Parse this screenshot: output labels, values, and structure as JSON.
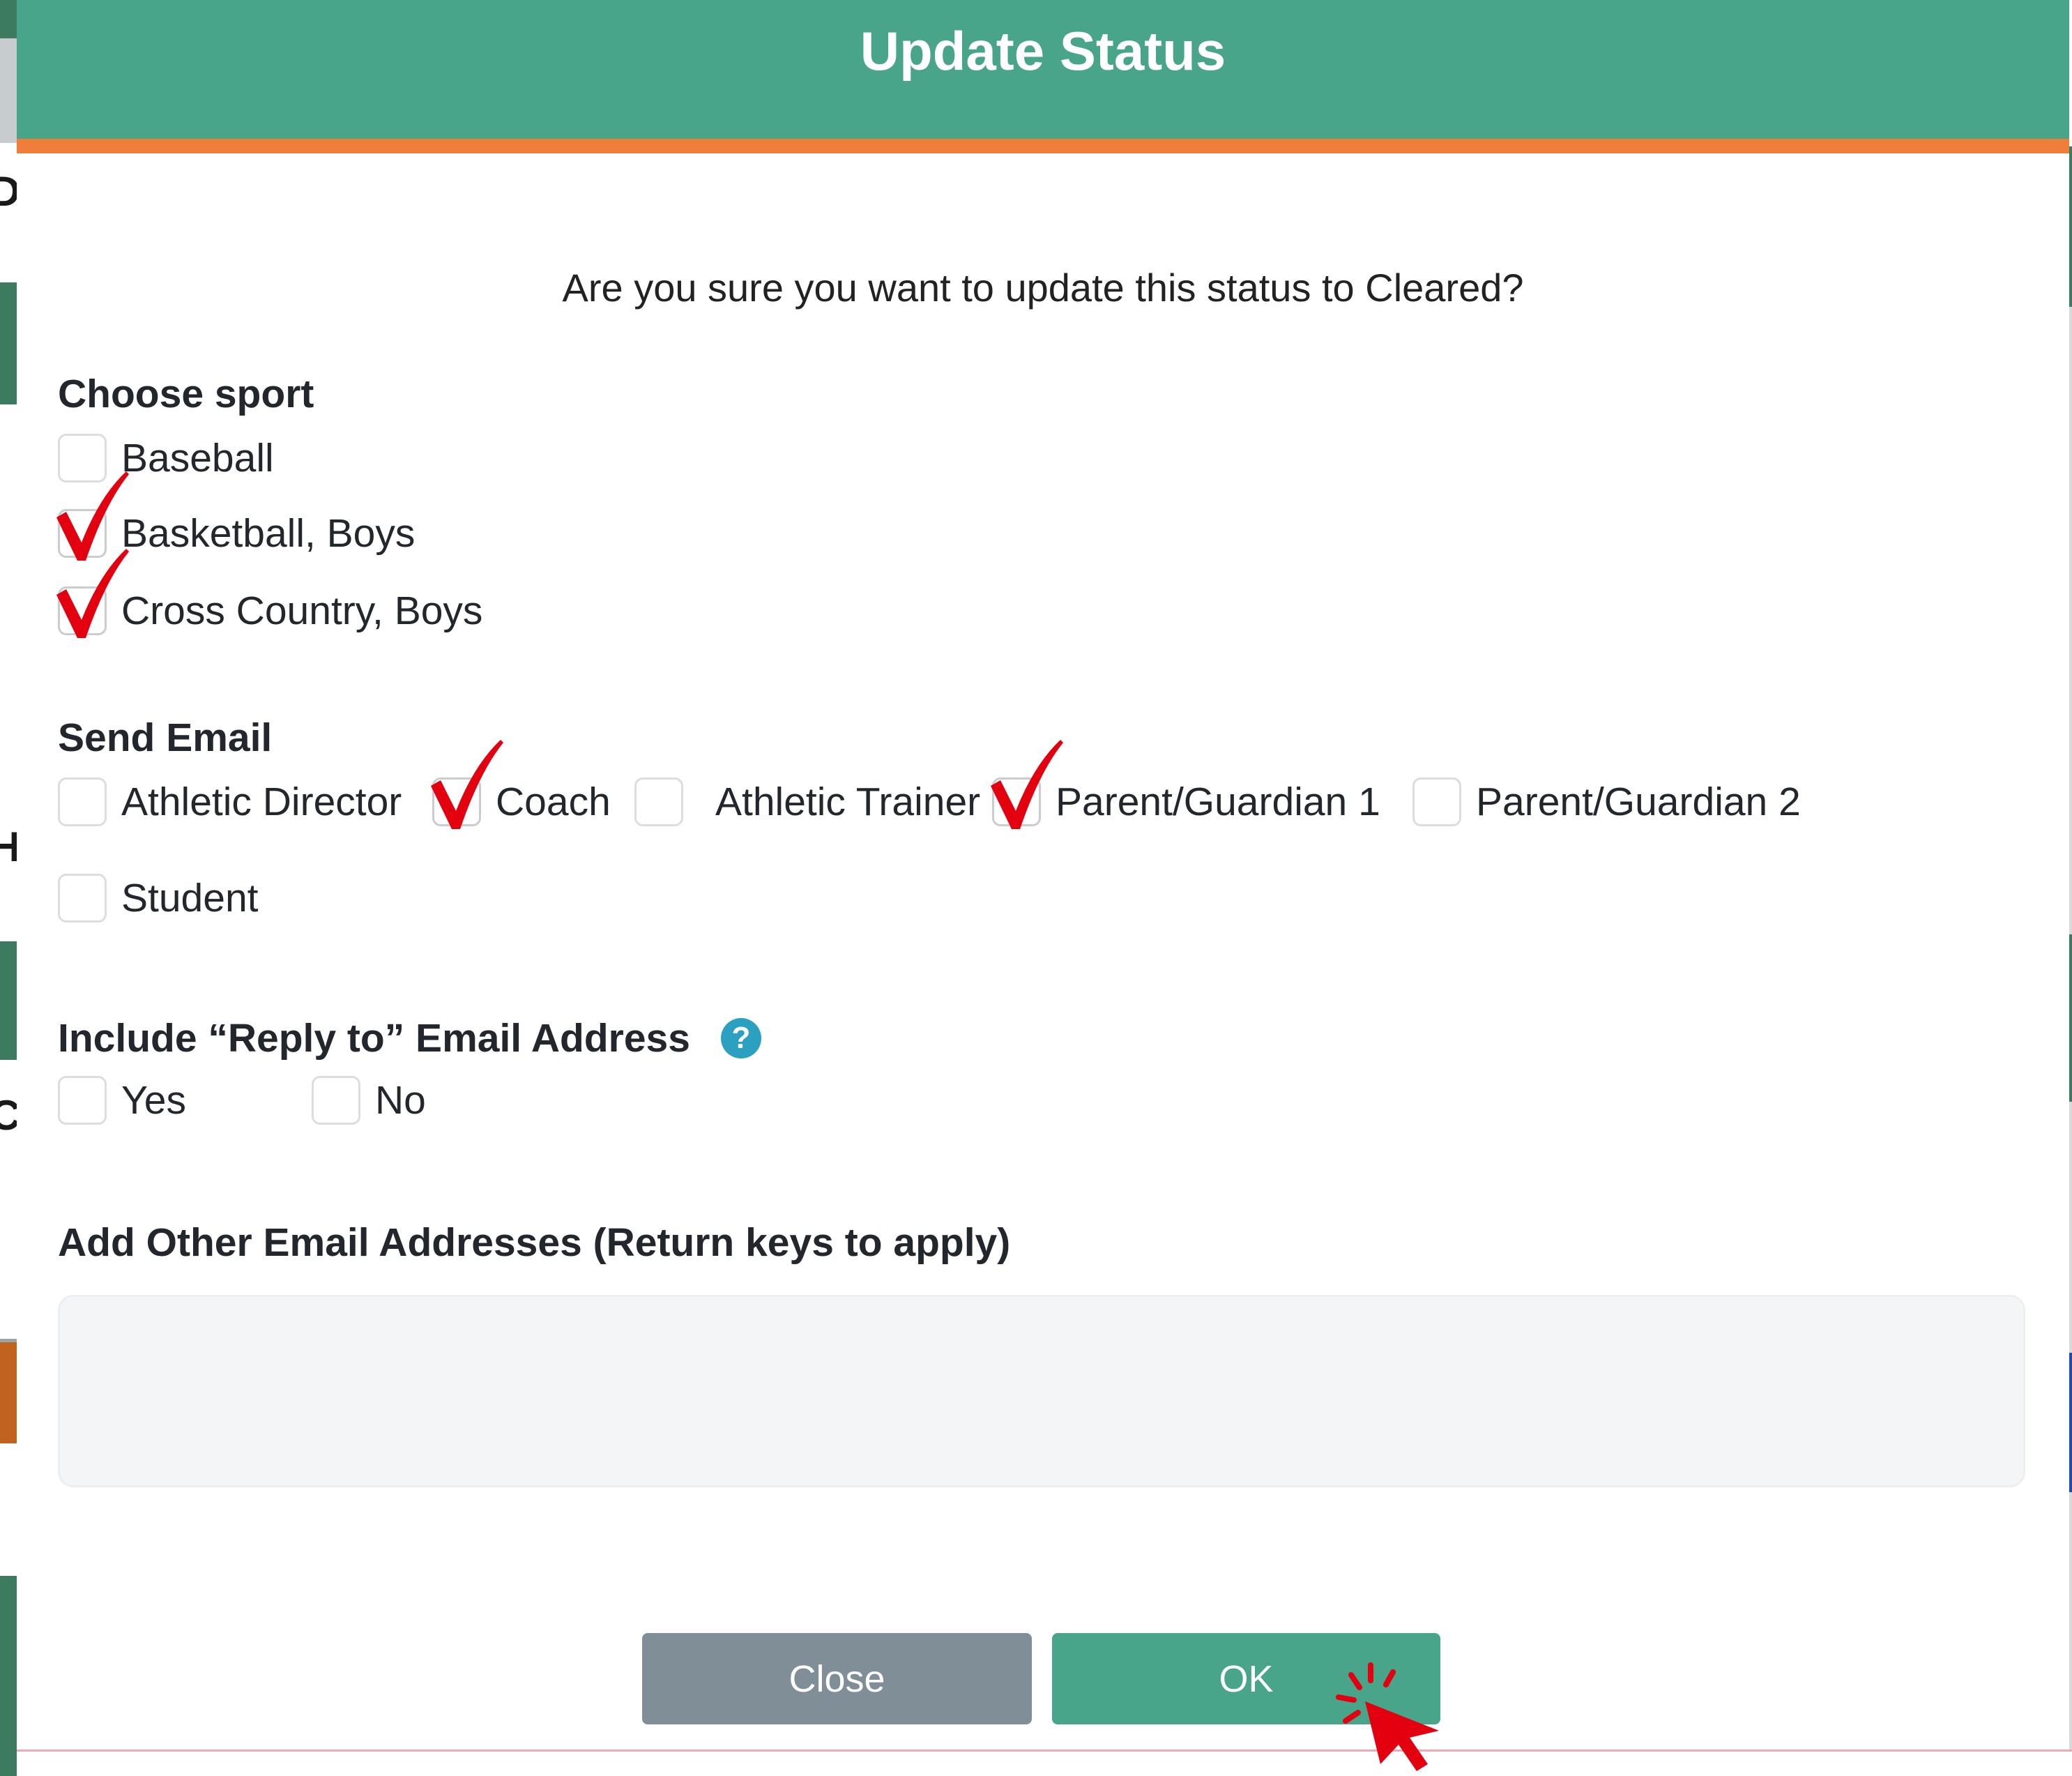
{
  "modal": {
    "title": "Update Status",
    "question": "Are you sure you want to update this status to Cleared?"
  },
  "sport": {
    "heading": "Choose sport",
    "options": [
      {
        "label": "Baseball",
        "checked": false
      },
      {
        "label": "Basketball, Boys",
        "checked": true
      },
      {
        "label": "Cross Country, Boys",
        "checked": true
      }
    ]
  },
  "send_email": {
    "heading": "Send Email",
    "options": [
      {
        "label": "Athletic Director",
        "checked": false
      },
      {
        "label": "Coach",
        "checked": true
      },
      {
        "label": "Athletic Trainer",
        "checked": false
      },
      {
        "label": "Parent/Guardian 1",
        "checked": true
      },
      {
        "label": "Parent/Guardian 2",
        "checked": false
      },
      {
        "label": "Student",
        "checked": false
      }
    ]
  },
  "reply_to": {
    "heading": "Include “Reply to” Email Address",
    "help_symbol": "?",
    "options": [
      {
        "label": "Yes",
        "checked": false
      },
      {
        "label": "No",
        "checked": false
      }
    ]
  },
  "other_emails": {
    "heading": "Add Other Email Addresses (Return keys to apply)",
    "value": ""
  },
  "buttons": {
    "close": "Close",
    "ok": "OK"
  },
  "colors": {
    "header": "#48a58a",
    "header_underline": "#f07e3a",
    "ok_button": "#48a58a",
    "close_button": "#808e98",
    "check_mark": "#e3000f",
    "help_icon": "#2ba0c0"
  },
  "icons": {
    "check_mark": "red-check-mark-icon",
    "help": "question-circle-icon",
    "cursor": "click-cursor-icon"
  }
}
